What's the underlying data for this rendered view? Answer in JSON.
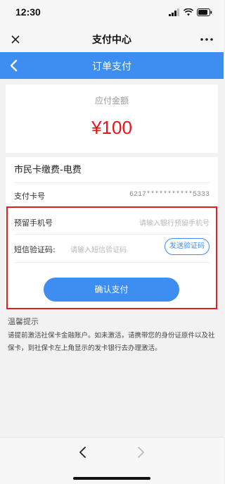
{
  "status_bar": {
    "time": "12:30",
    "icons": [
      "signal-icon",
      "wifi-icon",
      "battery-icon"
    ]
  },
  "wechat_header": {
    "title": "支付中心",
    "left_icon": "close-icon",
    "right_icon": "more-icon"
  },
  "page_header": {
    "title": "订单支付",
    "back_icon": "chevron-left-icon",
    "background_color": "#3d8ef0"
  },
  "amount": {
    "label": "应付金额",
    "value": "¥100",
    "color": "#e5161b"
  },
  "order": {
    "merchant": "市民卡缴费-电费",
    "card_label": "支付卡号",
    "card_number": "6217***********5333"
  },
  "form": {
    "phone_label": "预留手机号",
    "phone_placeholder": "请输入银行预留手机号",
    "sms_label": "短信验证码:",
    "sms_placeholder": "请输入短信验证码",
    "send_sms_button": "发送验证码",
    "confirm_button": "确认支付",
    "highlight_color": "#e02020"
  },
  "tips": {
    "title": "温馨提示",
    "body": "请提前激活社保卡金融账户。如未激活，请携带您的身份证原件以及社保卡，到社保卡左上角显示的发卡银行去办理激活。"
  },
  "bottom_nav": {
    "back_icon": "chevron-left-icon",
    "forward_icon": "chevron-right-icon"
  }
}
